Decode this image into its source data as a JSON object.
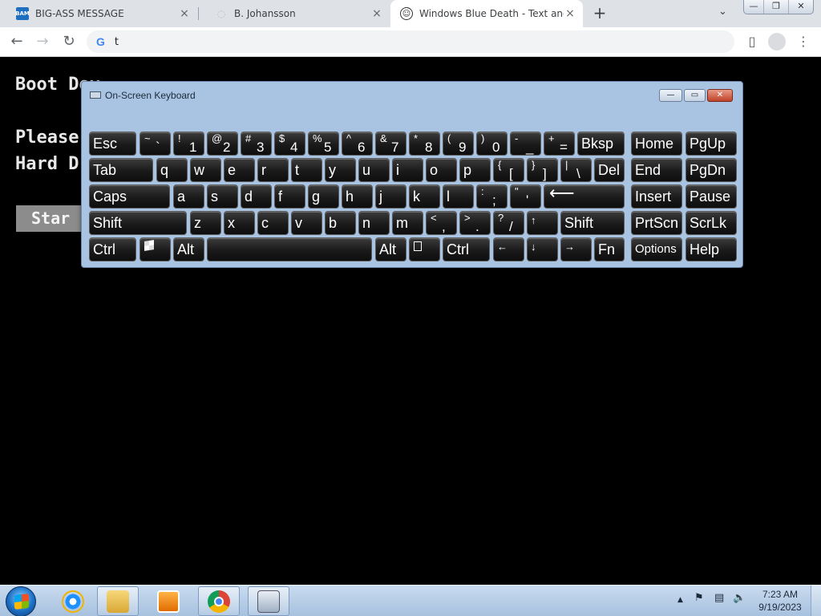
{
  "browser": {
    "tabs": [
      {
        "title": "BIG-ASS MESSAGE",
        "favicon": "BAM",
        "active": false
      },
      {
        "title": "B. Johansson",
        "favicon": "",
        "active": false
      },
      {
        "title": "Windows Blue Death - Text and A",
        "favicon": "troll-face",
        "active": true
      }
    ],
    "new_tab": "+",
    "tab_menu": "⌄",
    "window_buttons": {
      "minimize": "—",
      "restore": "❐",
      "close": "✕"
    },
    "nav": {
      "back": "←",
      "forward": "→",
      "reload": "↻"
    },
    "omnibox": {
      "icon": "G",
      "value": "t"
    },
    "toolbar_icons": {
      "sidepanel": "▯",
      "menu": "⋮"
    }
  },
  "page": {
    "lines": [
      "Boot Dev",
      "Please",
      "Hard D"
    ],
    "start_label": "Star"
  },
  "osk": {
    "title": "On-Screen Keyboard",
    "buttons": {
      "minimize": "—",
      "restore": "▭",
      "close": "✕"
    },
    "keys": [
      {
        "id": "esc",
        "label": "Esc"
      },
      {
        "id": "tilde",
        "label": "",
        "shift": "~",
        "main": "`"
      },
      {
        "id": "1",
        "shift": "!",
        "main": "1"
      },
      {
        "id": "2",
        "shift": "@",
        "main": "2"
      },
      {
        "id": "3",
        "shift": "#",
        "main": "3"
      },
      {
        "id": "4",
        "shift": "$",
        "main": "4"
      },
      {
        "id": "5",
        "shift": "%",
        "main": "5"
      },
      {
        "id": "6",
        "shift": "^",
        "main": "6"
      },
      {
        "id": "7",
        "shift": "&",
        "main": "7"
      },
      {
        "id": "8",
        "shift": "*",
        "main": "8"
      },
      {
        "id": "9",
        "shift": "(",
        "main": "9"
      },
      {
        "id": "0",
        "shift": ")",
        "main": "0"
      },
      {
        "id": "minus",
        "shift": "-",
        "main": "_"
      },
      {
        "id": "equals",
        "shift": "+",
        "main": "="
      },
      {
        "id": "bksp",
        "label": "Bksp"
      },
      {
        "id": "home",
        "label": "Home"
      },
      {
        "id": "pgup",
        "label": "PgUp"
      },
      {
        "id": "tab",
        "label": "Tab"
      },
      {
        "id": "q",
        "label": "q"
      },
      {
        "id": "w",
        "label": "w"
      },
      {
        "id": "e",
        "label": "e"
      },
      {
        "id": "r",
        "label": "r"
      },
      {
        "id": "t",
        "label": "t"
      },
      {
        "id": "y",
        "label": "y"
      },
      {
        "id": "u",
        "label": "u"
      },
      {
        "id": "i",
        "label": "i"
      },
      {
        "id": "o",
        "label": "o"
      },
      {
        "id": "p",
        "label": "p"
      },
      {
        "id": "lbracket",
        "shift": "{",
        "main": "["
      },
      {
        "id": "rbracket",
        "shift": "}",
        "main": "]"
      },
      {
        "id": "backslash",
        "shift": "|",
        "main": "\\"
      },
      {
        "id": "del",
        "label": "Del"
      },
      {
        "id": "end",
        "label": "End"
      },
      {
        "id": "pgdn",
        "label": "PgDn"
      },
      {
        "id": "caps",
        "label": "Caps"
      },
      {
        "id": "a",
        "label": "a"
      },
      {
        "id": "s",
        "label": "s"
      },
      {
        "id": "d",
        "label": "d"
      },
      {
        "id": "f",
        "label": "f"
      },
      {
        "id": "g",
        "label": "g"
      },
      {
        "id": "h",
        "label": "h"
      },
      {
        "id": "j",
        "label": "j"
      },
      {
        "id": "k",
        "label": "k"
      },
      {
        "id": "l",
        "label": "l"
      },
      {
        "id": "semicolon",
        "shift": ":",
        "main": ";"
      },
      {
        "id": "quote",
        "shift": "\"",
        "main": "'"
      },
      {
        "id": "enter",
        "label": "⟵"
      },
      {
        "id": "insert",
        "label": "Insert"
      },
      {
        "id": "pause",
        "label": "Pause"
      },
      {
        "id": "lshift",
        "label": "Shift"
      },
      {
        "id": "z",
        "label": "z"
      },
      {
        "id": "x",
        "label": "x"
      },
      {
        "id": "c",
        "label": "c"
      },
      {
        "id": "v",
        "label": "v"
      },
      {
        "id": "b",
        "label": "b"
      },
      {
        "id": "n",
        "label": "n"
      },
      {
        "id": "m",
        "label": "m"
      },
      {
        "id": "comma",
        "shift": "<",
        "main": ","
      },
      {
        "id": "period",
        "shift": ">",
        "main": "."
      },
      {
        "id": "slash",
        "shift": "?",
        "main": "/"
      },
      {
        "id": "up",
        "label": "↑"
      },
      {
        "id": "rshift",
        "label": "Shift"
      },
      {
        "id": "prtscn",
        "label": "PrtScn"
      },
      {
        "id": "scrlk",
        "label": "ScrLk"
      },
      {
        "id": "lctrl",
        "label": "Ctrl"
      },
      {
        "id": "win",
        "label": ""
      },
      {
        "id": "lalt",
        "label": "Alt"
      },
      {
        "id": "space",
        "label": ""
      },
      {
        "id": "ralt",
        "label": "Alt"
      },
      {
        "id": "menu",
        "label": ""
      },
      {
        "id": "rctrl",
        "label": "Ctrl"
      },
      {
        "id": "left",
        "label": "←"
      },
      {
        "id": "down",
        "label": "↓"
      },
      {
        "id": "right",
        "label": "→"
      },
      {
        "id": "fn",
        "label": "Fn"
      },
      {
        "id": "options",
        "label": "Options"
      },
      {
        "id": "help",
        "label": "Help"
      }
    ]
  },
  "taskbar": {
    "apps": [
      "internet-explorer-icon",
      "file-explorer-icon",
      "media-player-icon",
      "chrome-icon",
      "on-screen-keyboard-icon"
    ],
    "tray": {
      "show_hidden": "▲"
    },
    "time": "7:23 AM",
    "date": "9/19/2023"
  },
  "colors": {
    "bsod_bg": "#000000",
    "bsod_text": "#e8e8e8",
    "osk_frame": "#a9c3e2",
    "taskbar": "#b9cfe8"
  }
}
